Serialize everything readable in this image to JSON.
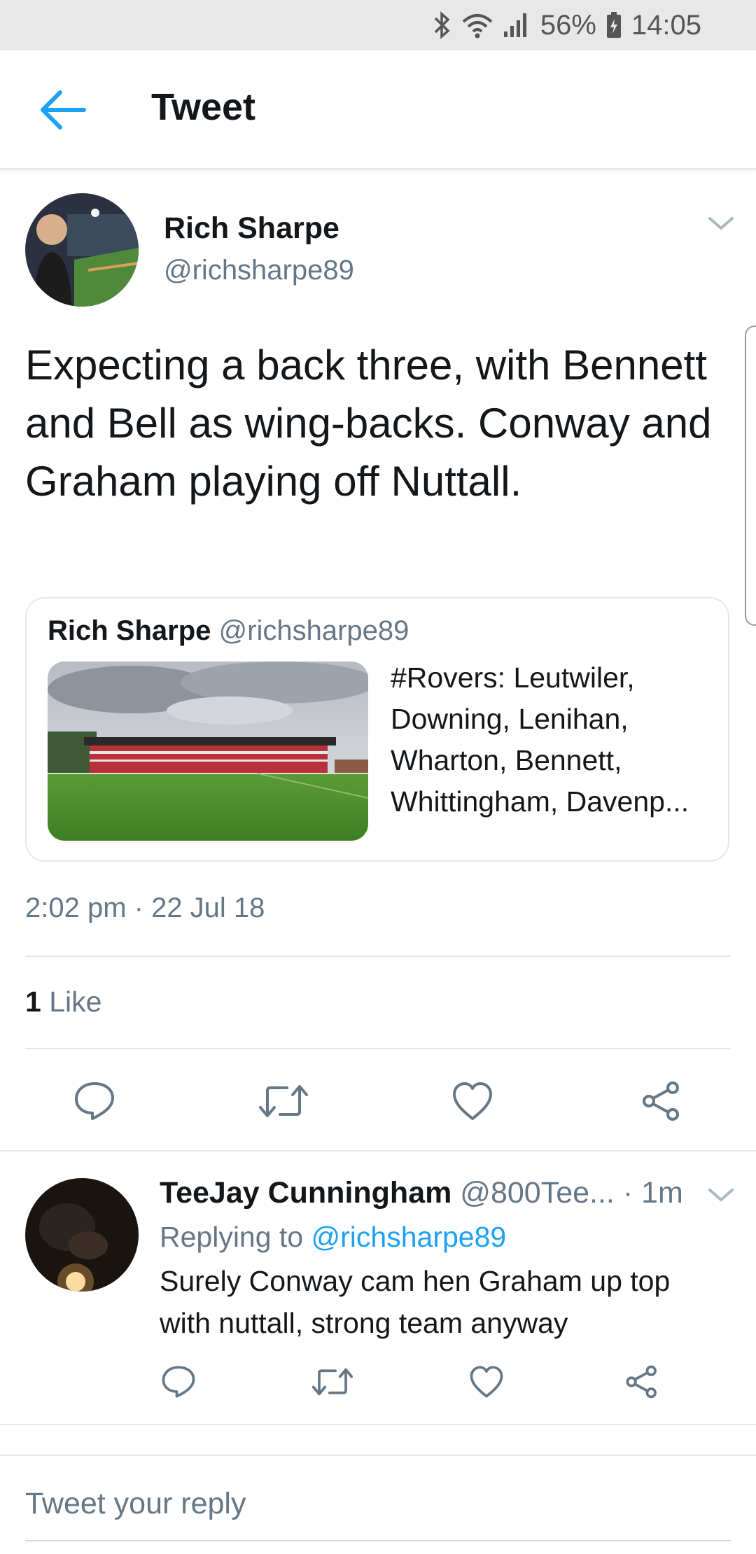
{
  "status_bar": {
    "battery": "56%",
    "time": "14:05"
  },
  "header": {
    "title": "Tweet"
  },
  "tweet": {
    "author_name": "Rich Sharpe",
    "author_handle": "@richsharpe89",
    "text": "Expecting a back three, with Bennett and Bell as wing-backs. Conway and Graham playing off Nuttall.",
    "quote": {
      "author_name": "Rich Sharpe",
      "author_handle": "@richsharpe89",
      "text": "#Rovers: Leutwiler, Downing, Lenihan, Wharton, Bennett, Whittingham, Davenp..."
    },
    "timestamp": "2:02 pm · 22 Jul 18",
    "like_count": "1",
    "like_label": "Like"
  },
  "reply": {
    "author_name": "TeeJay Cunningham",
    "author_handle": "@800Tee...",
    "time": "· 1m",
    "replying_prefix": "Replying to",
    "replying_to": "@richsharpe89",
    "text": "Surely Conway cam hen Graham up top with nuttall, strong team anyway"
  },
  "compose": {
    "placeholder": "Tweet your reply"
  },
  "colors": {
    "accent": "#1da1f2",
    "secondary_text": "#657786",
    "divider": "#e1e8ed"
  }
}
